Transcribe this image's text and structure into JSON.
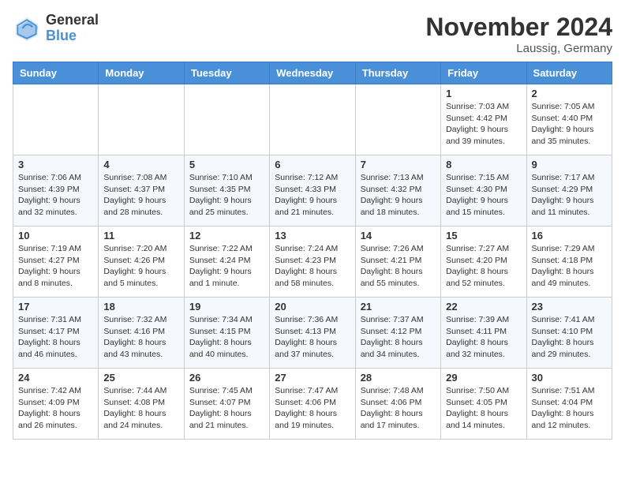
{
  "header": {
    "logo_general": "General",
    "logo_blue": "Blue",
    "month_title": "November 2024",
    "location": "Laussig, Germany"
  },
  "weekdays": [
    "Sunday",
    "Monday",
    "Tuesday",
    "Wednesday",
    "Thursday",
    "Friday",
    "Saturday"
  ],
  "weeks": [
    [
      {
        "day": "",
        "info": ""
      },
      {
        "day": "",
        "info": ""
      },
      {
        "day": "",
        "info": ""
      },
      {
        "day": "",
        "info": ""
      },
      {
        "day": "",
        "info": ""
      },
      {
        "day": "1",
        "info": "Sunrise: 7:03 AM\nSunset: 4:42 PM\nDaylight: 9 hours\nand 39 minutes."
      },
      {
        "day": "2",
        "info": "Sunrise: 7:05 AM\nSunset: 4:40 PM\nDaylight: 9 hours\nand 35 minutes."
      }
    ],
    [
      {
        "day": "3",
        "info": "Sunrise: 7:06 AM\nSunset: 4:39 PM\nDaylight: 9 hours\nand 32 minutes."
      },
      {
        "day": "4",
        "info": "Sunrise: 7:08 AM\nSunset: 4:37 PM\nDaylight: 9 hours\nand 28 minutes."
      },
      {
        "day": "5",
        "info": "Sunrise: 7:10 AM\nSunset: 4:35 PM\nDaylight: 9 hours\nand 25 minutes."
      },
      {
        "day": "6",
        "info": "Sunrise: 7:12 AM\nSunset: 4:33 PM\nDaylight: 9 hours\nand 21 minutes."
      },
      {
        "day": "7",
        "info": "Sunrise: 7:13 AM\nSunset: 4:32 PM\nDaylight: 9 hours\nand 18 minutes."
      },
      {
        "day": "8",
        "info": "Sunrise: 7:15 AM\nSunset: 4:30 PM\nDaylight: 9 hours\nand 15 minutes."
      },
      {
        "day": "9",
        "info": "Sunrise: 7:17 AM\nSunset: 4:29 PM\nDaylight: 9 hours\nand 11 minutes."
      }
    ],
    [
      {
        "day": "10",
        "info": "Sunrise: 7:19 AM\nSunset: 4:27 PM\nDaylight: 9 hours\nand 8 minutes."
      },
      {
        "day": "11",
        "info": "Sunrise: 7:20 AM\nSunset: 4:26 PM\nDaylight: 9 hours\nand 5 minutes."
      },
      {
        "day": "12",
        "info": "Sunrise: 7:22 AM\nSunset: 4:24 PM\nDaylight: 9 hours\nand 1 minute."
      },
      {
        "day": "13",
        "info": "Sunrise: 7:24 AM\nSunset: 4:23 PM\nDaylight: 8 hours\nand 58 minutes."
      },
      {
        "day": "14",
        "info": "Sunrise: 7:26 AM\nSunset: 4:21 PM\nDaylight: 8 hours\nand 55 minutes."
      },
      {
        "day": "15",
        "info": "Sunrise: 7:27 AM\nSunset: 4:20 PM\nDaylight: 8 hours\nand 52 minutes."
      },
      {
        "day": "16",
        "info": "Sunrise: 7:29 AM\nSunset: 4:18 PM\nDaylight: 8 hours\nand 49 minutes."
      }
    ],
    [
      {
        "day": "17",
        "info": "Sunrise: 7:31 AM\nSunset: 4:17 PM\nDaylight: 8 hours\nand 46 minutes."
      },
      {
        "day": "18",
        "info": "Sunrise: 7:32 AM\nSunset: 4:16 PM\nDaylight: 8 hours\nand 43 minutes."
      },
      {
        "day": "19",
        "info": "Sunrise: 7:34 AM\nSunset: 4:15 PM\nDaylight: 8 hours\nand 40 minutes."
      },
      {
        "day": "20",
        "info": "Sunrise: 7:36 AM\nSunset: 4:13 PM\nDaylight: 8 hours\nand 37 minutes."
      },
      {
        "day": "21",
        "info": "Sunrise: 7:37 AM\nSunset: 4:12 PM\nDaylight: 8 hours\nand 34 minutes."
      },
      {
        "day": "22",
        "info": "Sunrise: 7:39 AM\nSunset: 4:11 PM\nDaylight: 8 hours\nand 32 minutes."
      },
      {
        "day": "23",
        "info": "Sunrise: 7:41 AM\nSunset: 4:10 PM\nDaylight: 8 hours\nand 29 minutes."
      }
    ],
    [
      {
        "day": "24",
        "info": "Sunrise: 7:42 AM\nSunset: 4:09 PM\nDaylight: 8 hours\nand 26 minutes."
      },
      {
        "day": "25",
        "info": "Sunrise: 7:44 AM\nSunset: 4:08 PM\nDaylight: 8 hours\nand 24 minutes."
      },
      {
        "day": "26",
        "info": "Sunrise: 7:45 AM\nSunset: 4:07 PM\nDaylight: 8 hours\nand 21 minutes."
      },
      {
        "day": "27",
        "info": "Sunrise: 7:47 AM\nSunset: 4:06 PM\nDaylight: 8 hours\nand 19 minutes."
      },
      {
        "day": "28",
        "info": "Sunrise: 7:48 AM\nSunset: 4:06 PM\nDaylight: 8 hours\nand 17 minutes."
      },
      {
        "day": "29",
        "info": "Sunrise: 7:50 AM\nSunset: 4:05 PM\nDaylight: 8 hours\nand 14 minutes."
      },
      {
        "day": "30",
        "info": "Sunrise: 7:51 AM\nSunset: 4:04 PM\nDaylight: 8 hours\nand 12 minutes."
      }
    ]
  ]
}
